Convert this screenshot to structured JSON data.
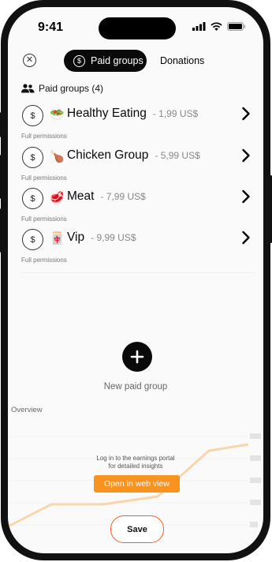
{
  "status_bar": {
    "time": "9:41"
  },
  "tabs": {
    "paid_groups": "Paid groups",
    "donations": "Donations"
  },
  "section": {
    "title": "Paid groups (4)"
  },
  "groups": [
    {
      "emoji": "🥗",
      "name": "Healthy Eating",
      "price": "- 1,99 US$",
      "permission": "Full permissions"
    },
    {
      "emoji": "🍗",
      "name": "Chicken Group",
      "price": "- 5,99 US$",
      "permission": "Full permissions"
    },
    {
      "emoji": "🥩",
      "name": "Meat",
      "price": "- 7,99 US$",
      "permission": "Full permissions"
    },
    {
      "emoji": "🀄",
      "name": "Vip",
      "price": "- 9,99 US$",
      "permission": "Full permissions"
    }
  ],
  "new_group": {
    "label": "New paid group"
  },
  "overview": {
    "label": "Overview",
    "portal_line1": "Log in to the earnings portal",
    "portal_line2": "for detailed insights",
    "web_view_button": "Open in web view"
  },
  "save_button": "Save",
  "colors": {
    "accent": "#f7931e",
    "save_border": "#ff5a1f",
    "dark": "#0a0a0a"
  }
}
